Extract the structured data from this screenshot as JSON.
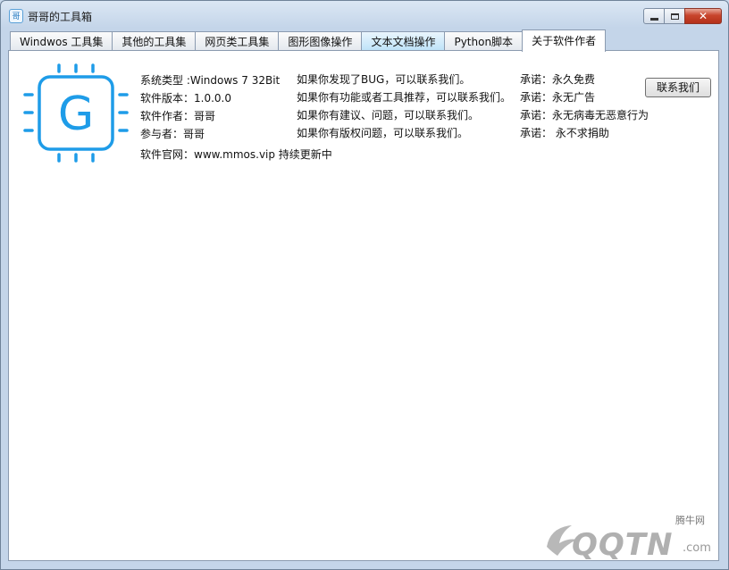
{
  "window": {
    "title": "哥哥的工具箱",
    "icon_text": "哥",
    "close_glyph": "✕"
  },
  "tabs": [
    {
      "label": "Windwos 工具集"
    },
    {
      "label": "其他的工具集"
    },
    {
      "label": "网页类工具集"
    },
    {
      "label": "图形图像操作"
    },
    {
      "label": "文本文档操作"
    },
    {
      "label": "Python脚本"
    },
    {
      "label": "关于软件作者"
    }
  ],
  "about": {
    "logo_letter": "G",
    "info": [
      "系统类型 :Windows 7 32Bit",
      "软件版本：1.0.0.0",
      "软件作者：哥哥",
      "参与者：哥哥"
    ],
    "website": "软件官网：www.mmos.vip  持续更新中",
    "contact_lines": [
      "如果你发现了BUG，可以联系我们。",
      "如果你有功能或者工具推荐，可以联系我们。",
      "如果你有建议、问题，可以联系我们。",
      "如果你有版权问题，可以联系我们。"
    ],
    "promises": [
      "承诺：永久免费",
      "承诺：永无广告",
      "承诺：永无病毒无恶意行为",
      "承诺： 永不求捐助"
    ],
    "contact_button": "联系我们"
  },
  "watermark": {
    "cn": "腾牛网",
    "en": "QQTN",
    "suffix": ".com"
  },
  "colors": {
    "logo_blue": "#1e9ce8",
    "tab_hover": "#bde2f8"
  }
}
